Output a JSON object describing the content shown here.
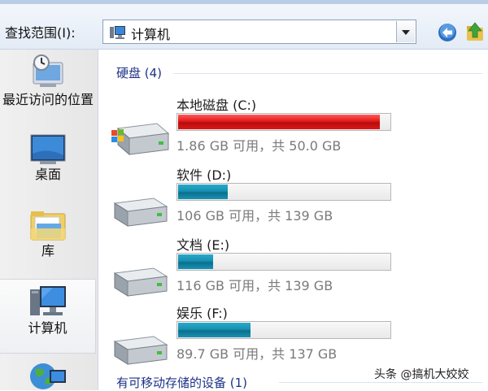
{
  "toolbar": {
    "look_in_label": "查找范围(I):",
    "location": "计算机",
    "back_icon": "back-arrow-icon",
    "up_icon": "up-folder-icon"
  },
  "sidebar": {
    "items": [
      {
        "label": "最近访问的位置",
        "icon": "recent-places-icon"
      },
      {
        "label": "桌面",
        "icon": "desktop-icon"
      },
      {
        "label": "库",
        "icon": "libraries-icon"
      },
      {
        "label": "计算机",
        "icon": "computer-icon",
        "selected": true
      },
      {
        "label": "",
        "icon": "network-icon"
      }
    ]
  },
  "groups": {
    "hard_disks": "硬盘 (4)",
    "removable": "有可移动存储的设备 (1)"
  },
  "drives": [
    {
      "name": "本地磁盘 (C:)",
      "status": "1.86 GB 可用，共 50.0 GB",
      "used_fraction": 0.963,
      "color": "#d81818"
    },
    {
      "name": "软件 (D:)",
      "status": "106 GB 可用，共 139 GB",
      "used_fraction": 0.237,
      "color": "#1690b1"
    },
    {
      "name": "文档 (E:)",
      "status": "116 GB 可用，共 139 GB",
      "used_fraction": 0.165,
      "color": "#1690b1"
    },
    {
      "name": "娱乐 (F:)",
      "status": "89.7 GB 可用，共 137 GB",
      "used_fraction": 0.345,
      "color": "#1690b1"
    }
  ],
  "watermark": "头条 @搞机大姣姣"
}
